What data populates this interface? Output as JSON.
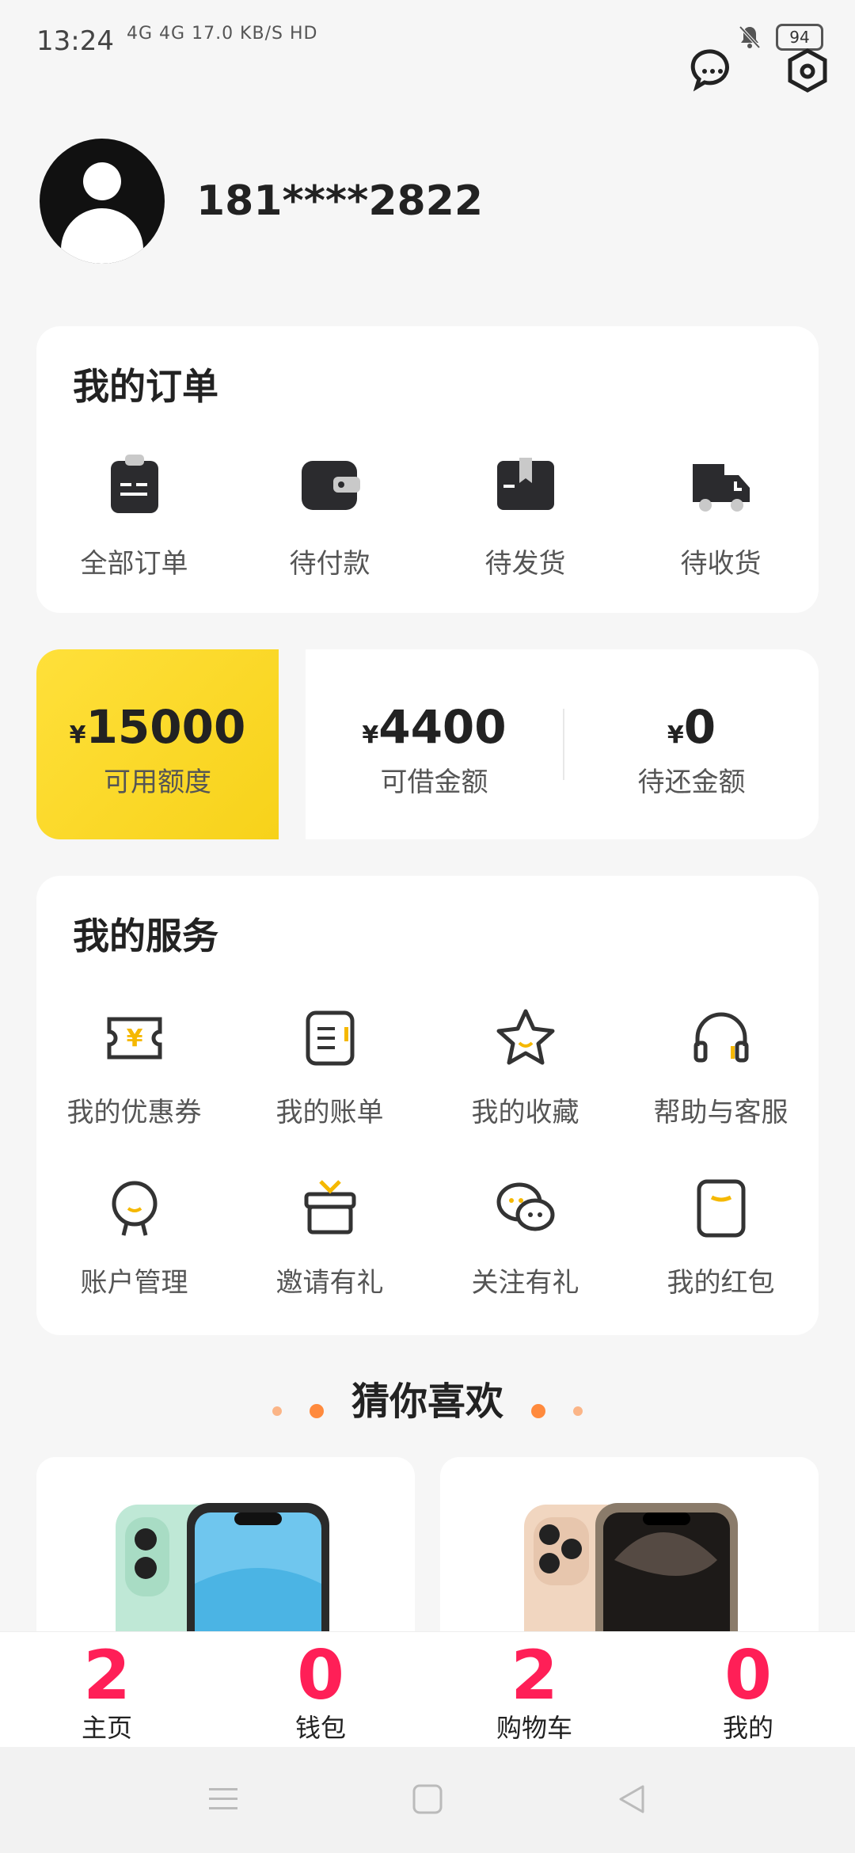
{
  "status_bar": {
    "time": "13:24",
    "network": "4G 4G 17.0 KB/S HD",
    "battery": "94"
  },
  "profile": {
    "phone": "181****2822"
  },
  "orders": {
    "title": "我的订单",
    "items": [
      {
        "label": "全部订单",
        "icon": "clipboard-icon"
      },
      {
        "label": "待付款",
        "icon": "wallet-icon"
      },
      {
        "label": "待发货",
        "icon": "package-icon"
      },
      {
        "label": "待收货",
        "icon": "truck-icon"
      }
    ]
  },
  "credit": {
    "yen": "¥",
    "available": {
      "amount": "15000",
      "label": "可用额度"
    },
    "borrowable": {
      "amount": "4400",
      "label": "可借金额"
    },
    "repay": {
      "amount": "0",
      "label": "待还金额"
    }
  },
  "services": {
    "title": "我的服务",
    "items": [
      {
        "label": "我的优惠券",
        "icon": "coupon-icon"
      },
      {
        "label": "我的账单",
        "icon": "bill-icon"
      },
      {
        "label": "我的收藏",
        "icon": "star-icon"
      },
      {
        "label": "帮助与客服",
        "icon": "headset-icon"
      },
      {
        "label": "账户管理",
        "icon": "user-icon"
      },
      {
        "label": "邀请有礼",
        "icon": "gift-icon"
      },
      {
        "label": "关注有礼",
        "icon": "chat-icon"
      },
      {
        "label": "我的红包",
        "icon": "red-packet-icon"
      }
    ]
  },
  "recommend": {
    "title": "猜你喜欢"
  },
  "tabbar": {
    "tabs": [
      {
        "num": "2",
        "label": "主页"
      },
      {
        "num": "0",
        "label": "钱包"
      },
      {
        "num": "2",
        "label": "购物车"
      },
      {
        "num": "0",
        "label": "我的"
      }
    ]
  },
  "colors": {
    "accent": "#ffd92a",
    "tab_red": "#ff1f57",
    "dot_orange": "#ff8a3d"
  }
}
